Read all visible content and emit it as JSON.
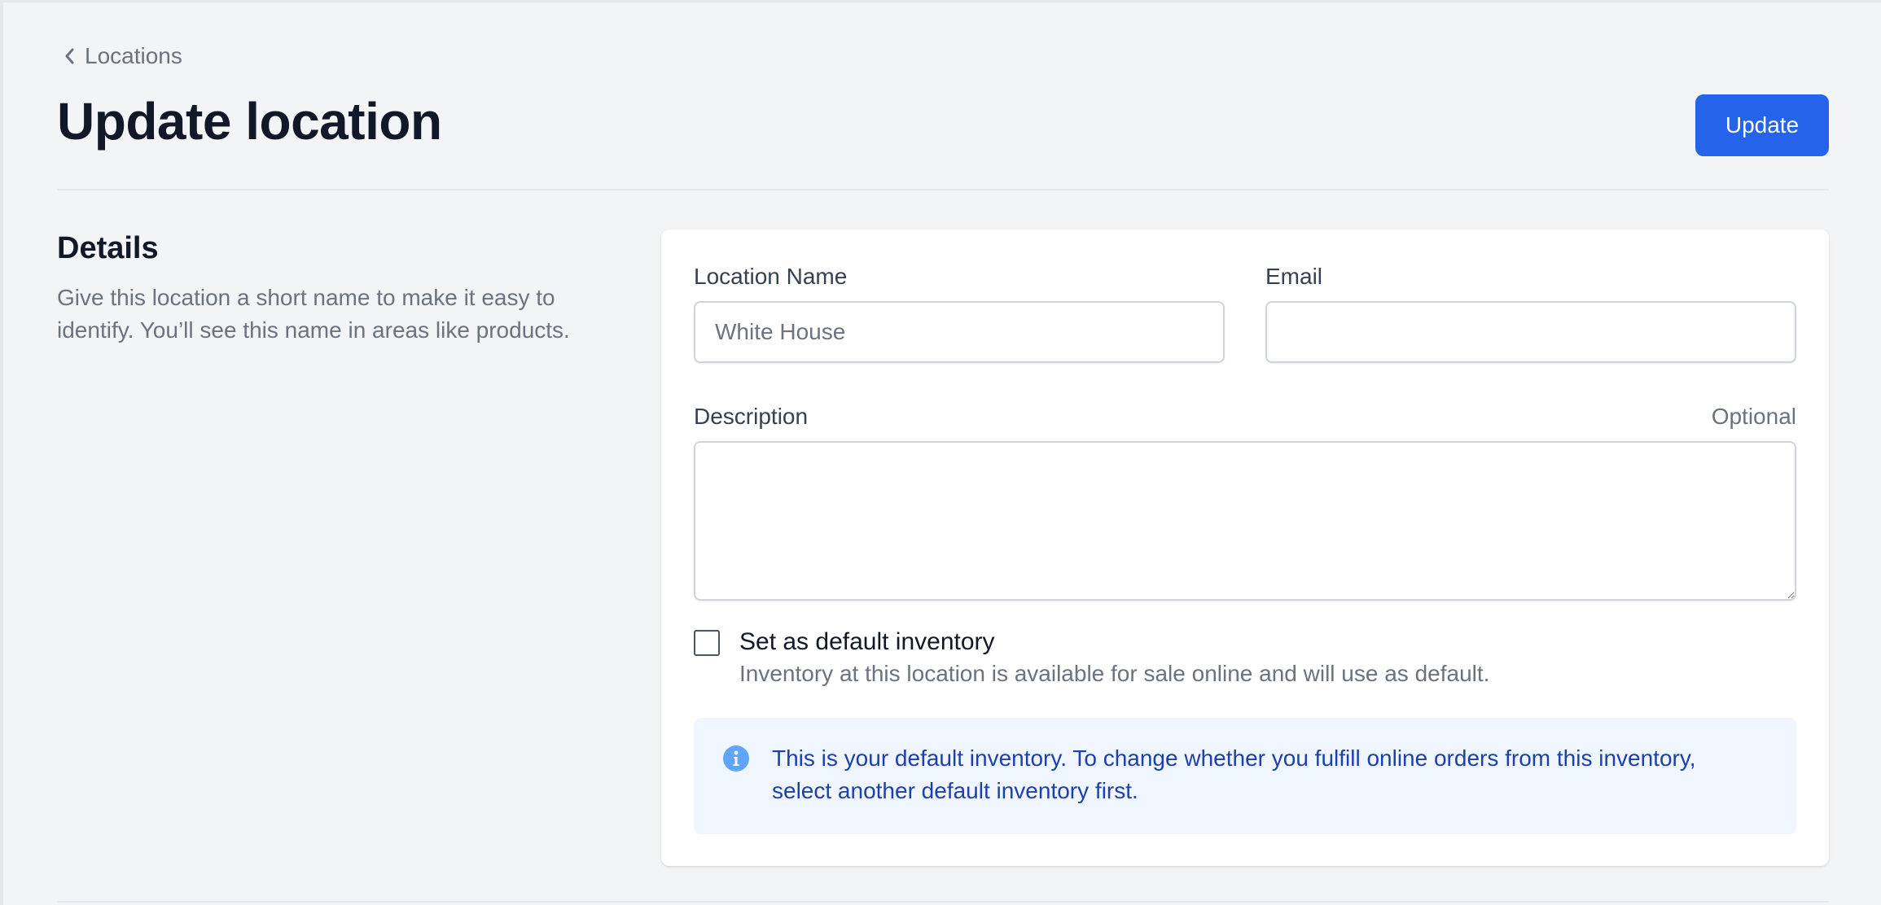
{
  "breadcrumb": {
    "label": "Locations",
    "icon": "chevron-left-icon"
  },
  "header": {
    "title": "Update location",
    "update_label": "Update"
  },
  "details": {
    "heading": "Details",
    "description": "Give this location a short name to make it easy to identify. You’ll see this name in areas like products."
  },
  "form": {
    "location_name": {
      "label": "Location Name",
      "value": "",
      "placeholder": "White House"
    },
    "email": {
      "label": "Email",
      "value": "",
      "placeholder": ""
    },
    "description": {
      "label": "Description",
      "optional_label": "Optional",
      "value": ""
    },
    "default_inventory": {
      "label": "Set as default inventory",
      "help": "Inventory at this location is available for sale online and will use as default.",
      "checked": false
    },
    "info_banner": {
      "icon": "info-icon",
      "text": "This is your default inventory. To change whether you fulfill online orders from this inventory, select another default inventory first."
    }
  },
  "colors": {
    "background": "#f3f4f6",
    "primary": "#2563eb",
    "info_bg": "#eff6ff",
    "info_text": "#1e40af",
    "info_icon": "#60a5fa"
  }
}
